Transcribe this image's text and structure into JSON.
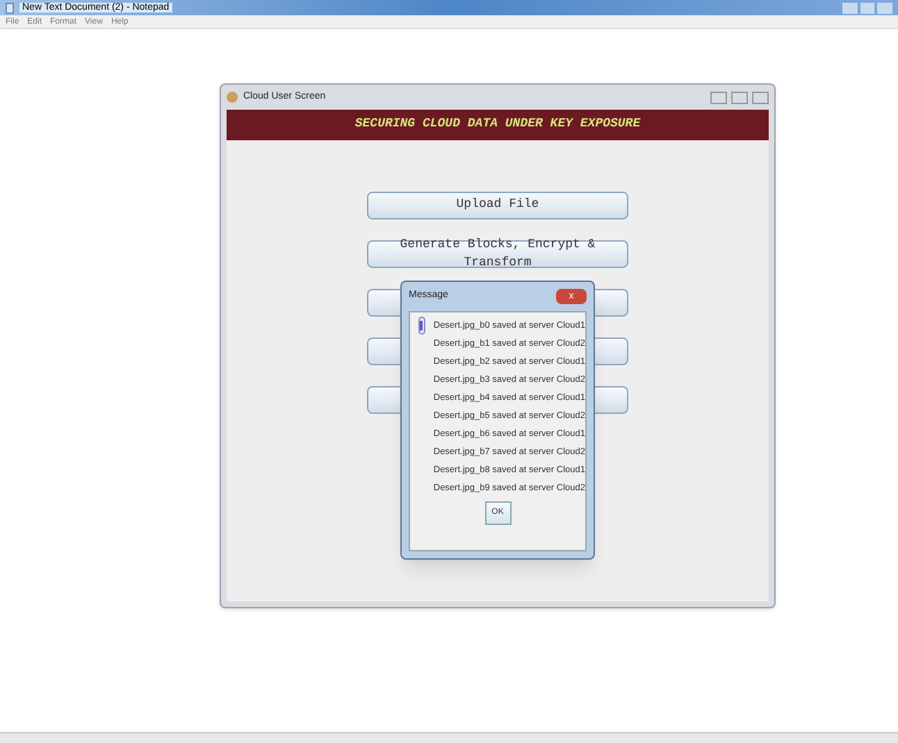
{
  "notepad": {
    "title": "New Text Document (2) - Notepad",
    "menu": [
      "File",
      "Edit",
      "Format",
      "View",
      "Help"
    ]
  },
  "app_window": {
    "title": "Cloud User Screen",
    "banner": "SECURING CLOUD DATA UNDER KEY EXPOSURE",
    "buttons": [
      "Upload File",
      "Generate Blocks, Encrypt & Transform"
    ]
  },
  "dialog": {
    "title": "Message",
    "lines": [
      "Desert.jpg_b0 saved at server Cloud1",
      "Desert.jpg_b1 saved at server Cloud2",
      "Desert.jpg_b2 saved at server Cloud1",
      "Desert.jpg_b3 saved at server Cloud2",
      "Desert.jpg_b4 saved at server Cloud1",
      "Desert.jpg_b5 saved at server Cloud2",
      "Desert.jpg_b6 saved at server Cloud1",
      "Desert.jpg_b7 saved at server Cloud2",
      "Desert.jpg_b8 saved at server Cloud1",
      "Desert.jpg_b9 saved at server Cloud2"
    ],
    "ok": "OK",
    "close": "x"
  }
}
